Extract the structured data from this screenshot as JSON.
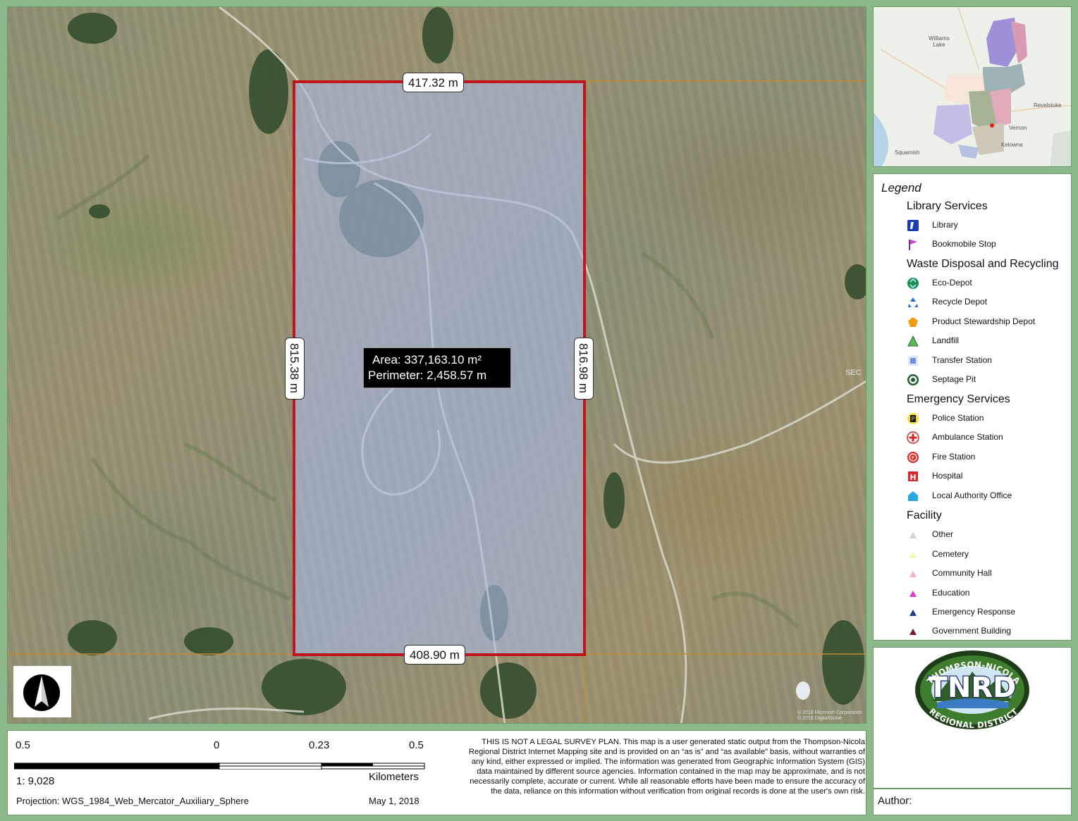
{
  "map": {
    "measurements": {
      "top": "417.32 m",
      "bottom": "408.90 m",
      "left": "815.38 m",
      "right": "816.98 m",
      "area": "Area: 337,163.10 m²",
      "perimeter": "Perimeter: 2,458.57 m"
    },
    "polygon_color": "#c0151c",
    "road_label": "SEC",
    "attribution": "© 2018 Microsoft Corporation  © 2018 DigitalGlobe"
  },
  "inset": {
    "cities": {
      "williams_lake": "Williams\nLake",
      "revelstoke": "Revelstoke",
      "vernon": "Vernon",
      "kelowna": "Kelowna",
      "squamish": "Squamish"
    }
  },
  "legend": {
    "title": "Legend",
    "groups": {
      "library": {
        "title": "Library Services",
        "items": [
          {
            "label": "Library",
            "icon": "library-icon"
          },
          {
            "label": "Bookmobile Stop",
            "icon": "flag-icon"
          }
        ]
      },
      "waste": {
        "title": "Waste Disposal and Recycling",
        "items": [
          {
            "label": "Eco-Depot",
            "icon": "eco-depot-icon"
          },
          {
            "label": "Recycle Depot",
            "icon": "recycle-icon"
          },
          {
            "label": "Product Stewardship Depot",
            "icon": "pentagon-icon"
          },
          {
            "label": "Landfill",
            "icon": "triangle-icon"
          },
          {
            "label": "Transfer Station",
            "icon": "square-icon"
          },
          {
            "label": "Septage Pit",
            "icon": "target-icon"
          }
        ]
      },
      "emergency": {
        "title": "Emergency Services",
        "items": [
          {
            "label": "Police Station",
            "icon": "police-icon"
          },
          {
            "label": "Ambulance Station",
            "icon": "ambulance-icon"
          },
          {
            "label": "Fire Station",
            "icon": "fire-icon"
          },
          {
            "label": "Hospital",
            "icon": "hospital-icon"
          },
          {
            "label": "Local Authority Office",
            "icon": "house-icon"
          }
        ]
      },
      "facility": {
        "title": "Facility",
        "items": [
          {
            "label": "Other",
            "icon": "triangle-gray-icon"
          },
          {
            "label": "Cemetery",
            "icon": "triangle-yellow-icon"
          },
          {
            "label": "Community Hall",
            "icon": "triangle-pink-icon"
          },
          {
            "label": "Education",
            "icon": "triangle-magenta-icon"
          },
          {
            "label": "Emergency Response",
            "icon": "triangle-blue-icon"
          },
          {
            "label": "Government Building",
            "icon": "triangle-maroon-icon"
          }
        ]
      }
    }
  },
  "logo": {
    "top_text": "THOMPSON-NICOLA",
    "main_text": "TNRD",
    "bottom_text": "REGIONAL DISTRICT"
  },
  "author": {
    "label": "Author:"
  },
  "scale": {
    "labels": [
      "0.5",
      "0",
      "0.23",
      "0.5"
    ],
    "ratio": "1: 9,028",
    "unit": "Kilometers"
  },
  "projection": "Projection:  WGS_1984_Web_Mercator_Auxiliary_Sphere",
  "date": "May 1, 2018",
  "disclaimer": "THIS IS NOT A LEGAL SURVEY PLAN.  This map is a user generated static output from the Thompson-Nicola Regional District Internet Mapping site and is provided on an “as is” and “as available” basis, without warranties of any kind, either expressed or implied.  The information was generated from Geographic Information System (GIS) data maintained by different source agencies. Information contained in the map may be approximate, and is not necessarily complete, accurate or current.  While all reasonable efforts have been made to ensure the accuracy of the data, reliance on this information without verification from original records is done at the user's own risk."
}
